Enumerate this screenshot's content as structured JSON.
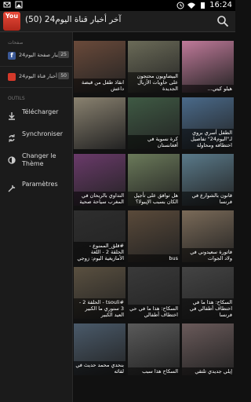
{
  "status_bar": {
    "time": "16:24"
  },
  "action_bar": {
    "app_icon_text": "You",
    "title": "آخر أخبار قناة اليوم24 (50)"
  },
  "drawer": {
    "pages_section": "صفحات",
    "pages": [
      {
        "label": "أخبار صفحة اليوم24",
        "count": "25",
        "color": "#3b5998"
      },
      {
        "label": "آخر أخبار قناة اليوم24",
        "count": "50",
        "color": "#d3392a"
      }
    ],
    "tools_section": "OUTILS",
    "tools": [
      {
        "label": "Télécharger",
        "icon": "download-icon"
      },
      {
        "label": "Synchroniser",
        "icon": "sync-icon"
      },
      {
        "label": "Changer le Thème",
        "icon": "theme-icon"
      },
      {
        "label": "Paramètres",
        "icon": "settings-icon"
      }
    ]
  },
  "videos": [
    {
      "caption": "انقاذ طفل من قبضة داعش",
      "color": "#6a4a3a"
    },
    {
      "caption": "البيضاويون محتجون على حاويات الأزبال الجديدة",
      "color": "#6b6b58"
    },
    {
      "caption": "هيلو كيتي...",
      "color": "#c07a9a"
    },
    {
      "caption": "",
      "color": "#8a8270"
    },
    {
      "caption": "كرة نسوية في أفغانستان",
      "color": "#3f5a44"
    },
    {
      "caption": "الطفل أسري بروي لـ\"اليوم24\" تفاصيل اختطافه ومحاولة",
      "color": "#4a6a8a"
    },
    {
      "caption": "التداوي بالريحان في المغرب سياحة صحية",
      "color": "#6a3a6a"
    },
    {
      "caption": "هل توافق على تأجيل الكان بسبب الإيبولا؟",
      "color": "#6b7a5a"
    },
    {
      "caption": "قانون بالشوارع في فرنسا",
      "color": "#5a7a8a"
    },
    {
      "caption": "#قلق_الممنوع - الحلقة 2 - اللغة الأمازيغية اليوم: زوجي يفتحني",
      "color": "#2e2e2e"
    },
    {
      "caption": "bus",
      "color": "#5a4a3a"
    },
    {
      "caption": "فاتورة سعيدوني في ولاد الجوات",
      "color": "#7a6a58"
    },
    {
      "caption": "#tsouli - الحلقة 2 - 3 ستوري ما الكبير العيد الكبير",
      "color": "#5a5040"
    },
    {
      "caption": "السكاح: هذا ما في حي اختطاف أطفالي",
      "color": "#3a3a3a"
    },
    {
      "caption": "السكاح: هذا ما في اختطاف أطفالي في فرنسا",
      "color": "#444444"
    },
    {
      "caption": "بنحدي محمد حديث في لقائه",
      "color": "#4a5a6a"
    },
    {
      "caption": "السكاح هذا سبب",
      "color": "#5a5a5a"
    },
    {
      "caption": "إيلي جديدي تلتقي",
      "color": "#6a5a5a"
    }
  ]
}
